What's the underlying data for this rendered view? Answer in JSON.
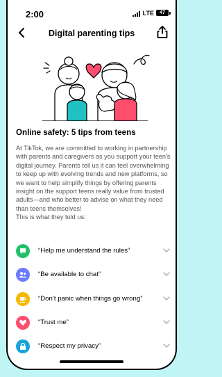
{
  "status_bar": {
    "time": "2:00",
    "network": "LTE",
    "battery": "47"
  },
  "nav": {
    "title": "Digital parenting tips",
    "back_icon": "chevron-left-icon",
    "share_icon": "share-icon"
  },
  "content": {
    "heading": "Online safety: 5 tips from teens",
    "body": "At TikTok, we are committed to working in partnership with parents and caregivers as you support your teen's digital journey. Parents tell us it can feel overwhelming to keep up with evolving trends and new platforms, so we want to help simplify things by offering parents insight on the support teens really value from trusted adults—and who better to advise on what they need than teens themselves!\nThis is what they told us:"
  },
  "tips": [
    {
      "label": "“Help me understand the rules”",
      "icon": "chat-bubble-icon",
      "color": "#22c06b"
    },
    {
      "label": "“Be available to chat”",
      "icon": "people-icon",
      "color": "#6b7cff"
    },
    {
      "label": "“Don’t panic when things go wrong”",
      "icon": "cup-icon",
      "color": "#f5b800"
    },
    {
      "label": "“Trust me”",
      "icon": "heart-icon",
      "color": "#ff4d6d"
    },
    {
      "label": "“Respect my privacy”",
      "icon": "lock-icon",
      "color": "#17a5d8"
    }
  ],
  "colors": {
    "accent_pink": "#ff4d6d",
    "page_background": "#bff5f5"
  }
}
